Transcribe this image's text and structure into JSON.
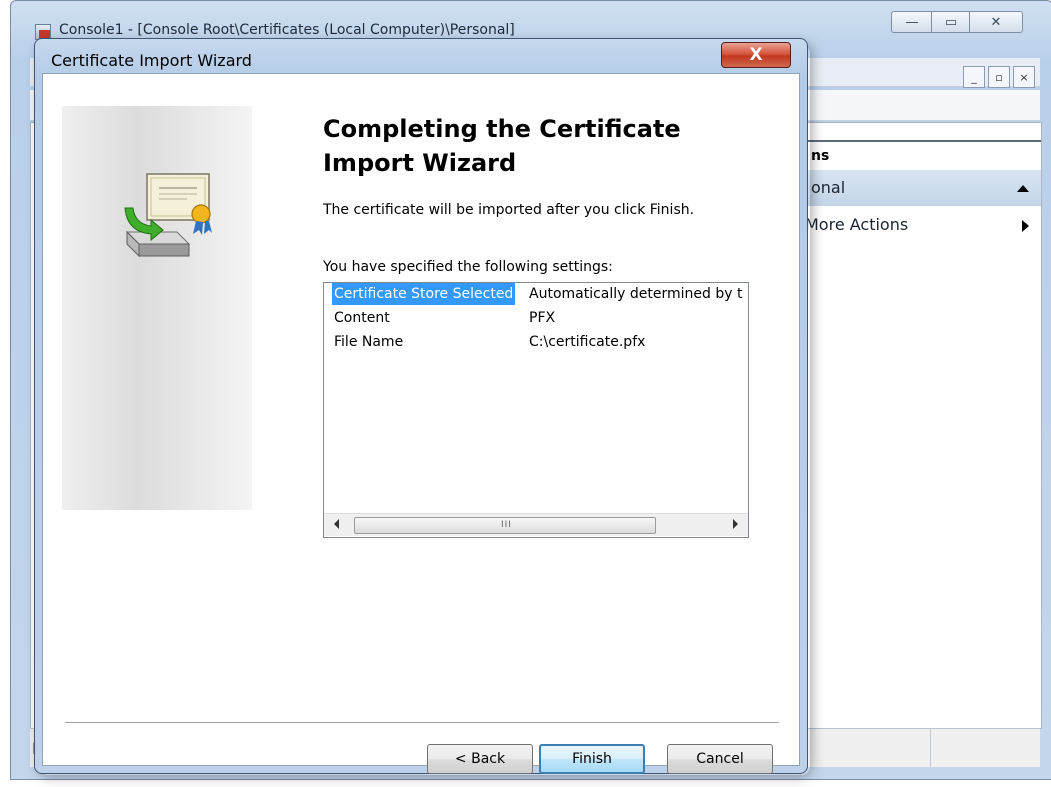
{
  "mmc": {
    "title": "Console1 - [Console Root\\Certificates (Local Computer)\\Personal]",
    "caption_min": "—",
    "caption_max": "▭",
    "caption_close": "✕",
    "mdi_min": "_",
    "mdi_restore": "▫",
    "mdi_close": "×",
    "actions_header": "ns",
    "actions_item_selected": "onal",
    "actions_item_more": "More Actions",
    "status_text": "P"
  },
  "wizard": {
    "title": "Certificate Import Wizard",
    "close_label": "X",
    "heading": "Completing the Certificate Import Wizard",
    "description": "The certificate will be imported after you click Finish.",
    "settings_label": "You have specified the following settings:",
    "settings": [
      {
        "name": "Certificate Store Selected",
        "value": "Automatically determined by t"
      },
      {
        "name": "Content",
        "value": "PFX"
      },
      {
        "name": "File Name",
        "value": "C:\\certificate.pfx"
      }
    ],
    "scroll_grip": "III",
    "buttons": {
      "back": "< Back",
      "finish": "Finish",
      "cancel": "Cancel"
    }
  },
  "colors": {
    "selection": "#3399ff",
    "dialog_frame": "#b3cbe6",
    "close_button": "#c2361e"
  },
  "icons": [
    "certificate-import-icon",
    "console-app-icon"
  ]
}
